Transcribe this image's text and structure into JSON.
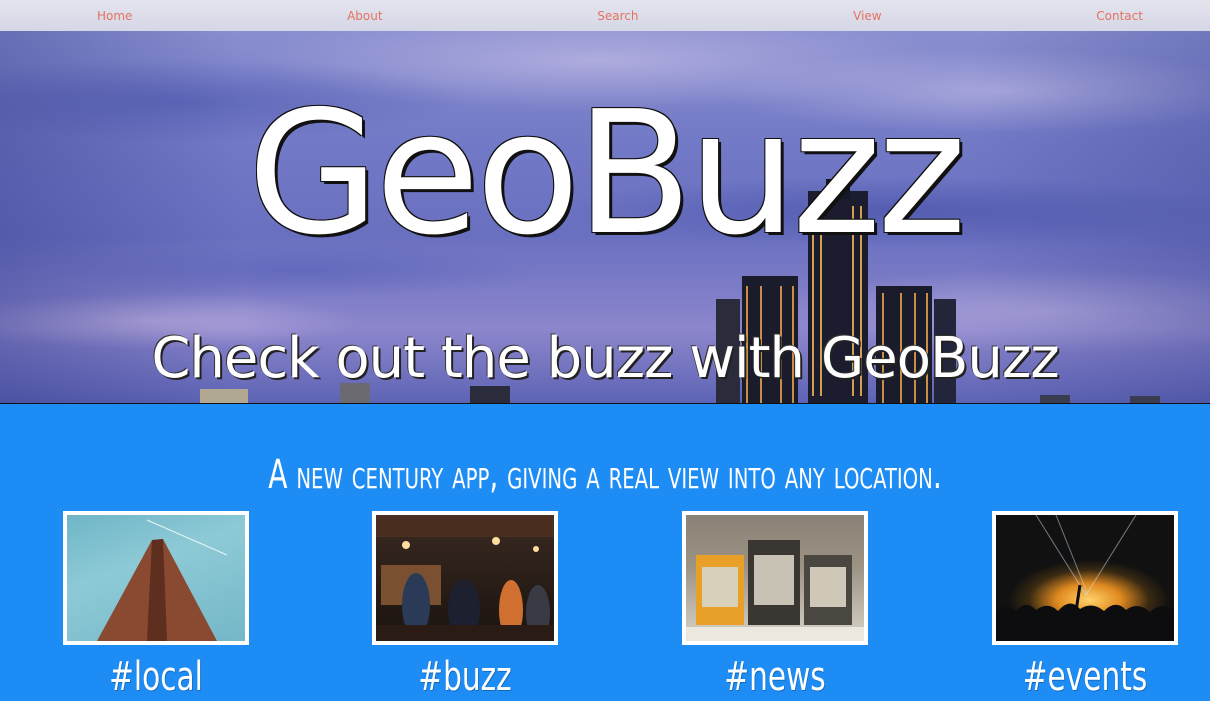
{
  "nav": {
    "items": [
      "Home",
      "About",
      "Search",
      "View",
      "Contact"
    ]
  },
  "hero": {
    "title": "GeoBuzz",
    "subtitle": "Check out the buzz with GeoBuzz"
  },
  "tagline": "A new century app, giving a real view into any location.",
  "cards": [
    {
      "label": "#local",
      "image": "skyscraper-photo"
    },
    {
      "label": "#buzz",
      "image": "crowded-bar-photo"
    },
    {
      "label": "#news",
      "image": "newspaper-boxes-photo"
    },
    {
      "label": "#events",
      "image": "concert-crowd-photo"
    }
  ],
  "colors": {
    "nav_link": "#e2735f",
    "section_bg": "#1e8cf5",
    "text": "#ffffff"
  }
}
